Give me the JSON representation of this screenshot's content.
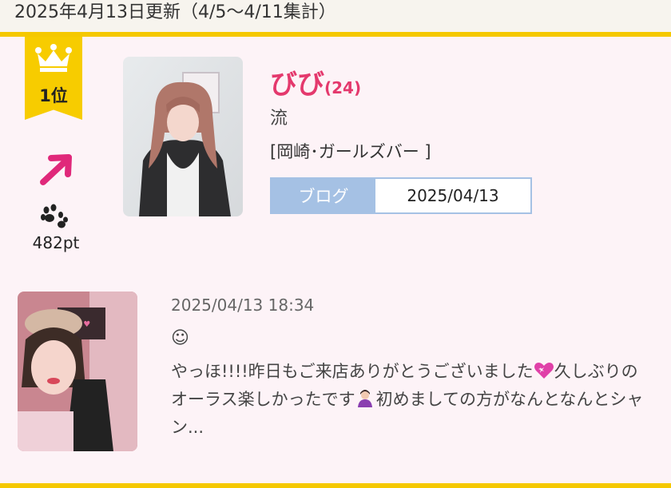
{
  "header": {
    "title": "2025年4月13日更新（4/5〜4/11集計）"
  },
  "ranking": {
    "rank_label": "1位",
    "trend": "up",
    "points": "482pt"
  },
  "profile": {
    "name": "びび",
    "age": "(24)",
    "tagline": "流",
    "shop": "[岡崎･ガールズバー ]",
    "blog_label": "ブログ",
    "blog_date": "2025/04/13"
  },
  "post": {
    "timestamp": "2025/04/13 18:34",
    "smiley": "☺",
    "excerpt_part1": "やっほ!!!!昨日もご来店ありがとうございました",
    "excerpt_part2": "久しぶりのオーラス楽しかったです",
    "excerpt_part3": "初めましての方がなんとなんとシャン..."
  },
  "colors": {
    "accent": "#f5c800",
    "name_pink": "#e4396d",
    "blog_blue": "#a5c1e4",
    "arrow_magenta": "#e0287a",
    "background": "#fdf3f7"
  }
}
